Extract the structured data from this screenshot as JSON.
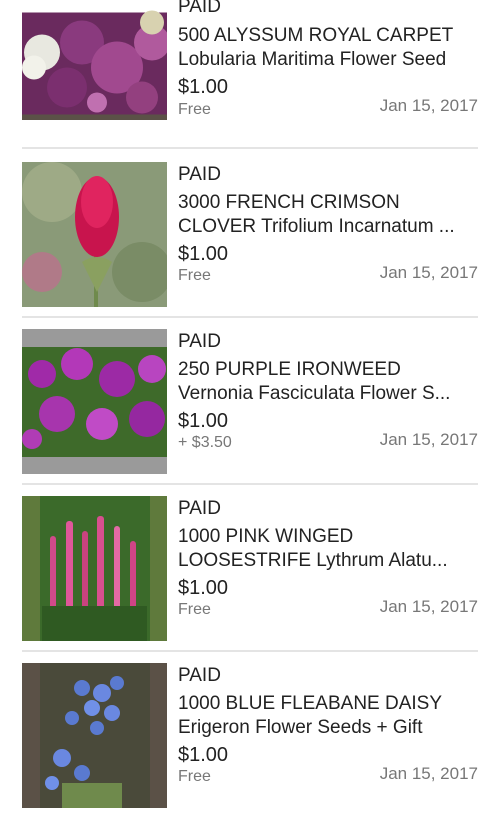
{
  "orders": [
    {
      "status": "PAID",
      "title_line1": "500 ALYSSUM ROYAL CARPET",
      "title_line2": "Lobularia Maritima Flower Seed",
      "price": "$1.00",
      "shipping": "Free",
      "date": "Jan 15, 2017",
      "thumb_icon": "alyssum-photo"
    },
    {
      "status": "PAID",
      "title_line1": "3000 FRENCH CRIMSON",
      "title_line2": "CLOVER Trifolium Incarnatum ...",
      "price": "$1.00",
      "shipping": "Free",
      "date": "Jan 15, 2017",
      "thumb_icon": "crimson-clover-photo"
    },
    {
      "status": "PAID",
      "title_line1": "250 PURPLE IRONWEED",
      "title_line2": "Vernonia Fasciculata Flower S...",
      "price": "$1.00",
      "shipping": "+ $3.50",
      "date": "Jan 15, 2017",
      "thumb_icon": "ironweed-photo"
    },
    {
      "status": "PAID",
      "title_line1": "1000 PINK WINGED",
      "title_line2": "LOOSESTRIFE Lythrum Alatu...",
      "price": "$1.00",
      "shipping": "Free",
      "date": "Jan 15, 2017",
      "thumb_icon": "loosestrife-photo"
    },
    {
      "status": "PAID",
      "title_line1": "1000 BLUE FLEABANE DAISY",
      "title_line2": "Erigeron Flower Seeds + Gift",
      "price": "$1.00",
      "shipping": "Free",
      "date": "Jan 15, 2017",
      "thumb_icon": "fleabane-photo"
    }
  ],
  "colors": {
    "thumb_border_dark": "#5b5147",
    "thumb_border_grey": "#9a9a9a",
    "thumb_border_green": "#5f7a3c"
  }
}
